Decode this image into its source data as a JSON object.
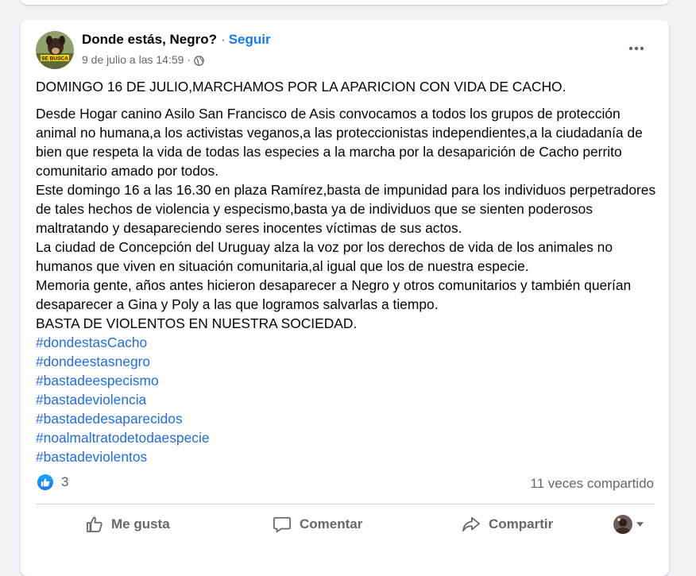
{
  "post": {
    "author": "Donde estás, Negro?",
    "separator": "·",
    "follow_label": "Seguir",
    "timestamp": "9 de julio a las 14:59",
    "meta_separator": "·",
    "avatar_caption": "SE BUSCA",
    "title_line": "DOMINGO 16 DE JULIO,MARCHAMOS POR LA APARICION CON VIDA DE CACHO.",
    "paragraphs": [
      "Desde Hogar canino Asilo San Francisco de Asis convocamos a todos los grupos de protección animal no humana,a los activistas veganos,a las proteccionistas independientes,a la ciudadanía de bien que respeta la vida de todas las especies a la marcha por la desaparición de Cacho perrito comunitario amado por todos.",
      "Este domingo 16 a las 16.30 en plaza Ramírez,basta de impunidad para los individuos perpetradores de tales hechos de violencia y especismo,basta ya de individuos que se sienten poderosos maltratando y desapareciendo seres inocentes víctimas de sus actos.",
      "La ciudad de Concepción del Uruguay alza la voz por los derechos de vida de los animales no humanos que viven en situación comunitaria,al igual que los de nuestra especie.",
      "Memoria gente, años antes hicieron desaparecer a Negro y otros comunitarios y también querían desaparecer a Gina y Poly a las que logramos salvarlas a tiempo.",
      "BASTA DE VIOLENTOS EN NUESTRA SOCIEDAD."
    ],
    "hashtags": [
      "#dondestasCacho",
      "#dondeestasnegro",
      "#bastadeespecismo",
      "#bastadeviolencia",
      "#bastadedesaparecidos",
      "#noalmaltratodetodaespecie",
      "#bastadeviolentos"
    ],
    "reaction_count": "3",
    "shares_text": "11 veces compartido",
    "actions": {
      "like": "Me gusta",
      "comment": "Comentar",
      "share": "Compartir"
    }
  },
  "icons": {
    "more": "more-dots-icon",
    "privacy": "globe-icon",
    "reaction": "like-reaction-icon",
    "like": "thumbs-up-icon",
    "comment": "comment-bubble-icon",
    "share": "share-arrow-icon",
    "audience_caret": "caret-down-icon"
  },
  "colors": {
    "link": "#216fdb",
    "follow": "#1877f2",
    "secondary_text": "#65676b",
    "background": "#f0f2f5"
  }
}
